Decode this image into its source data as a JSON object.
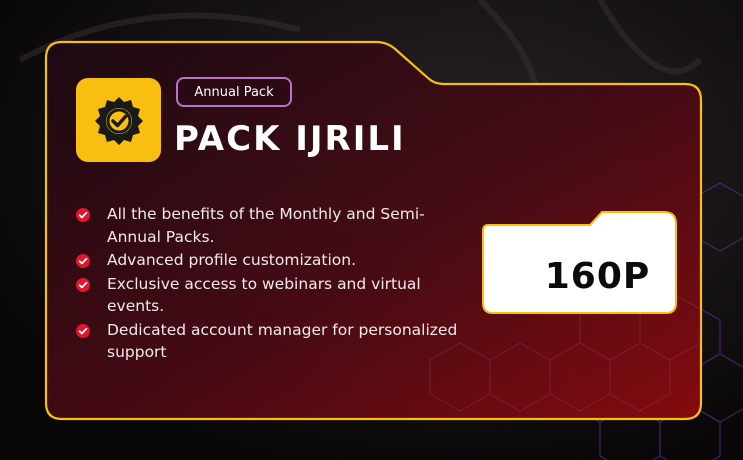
{
  "card": {
    "tag": "Annual Pack",
    "title": "PACK IJRILI",
    "price": "160P",
    "features": [
      {
        "text": "All the benefits of the Monthly and Semi-Annual Packs."
      },
      {
        "text": "Advanced profile customization."
      },
      {
        "text": "Exclusive access to webinars and virtual events."
      },
      {
        "text": "Dedicated account manager for personalized support"
      }
    ]
  },
  "icons": {
    "badge": "verified-badge-icon",
    "bullet": "check-circle-icon"
  },
  "colors": {
    "accent": "#f8bf11",
    "check": "#e0162b",
    "pill_border": "#b874c8",
    "card_gradient_start": "#1a0b12",
    "card_gradient_end": "#7a0a0c",
    "page_background": "#0a0708"
  }
}
